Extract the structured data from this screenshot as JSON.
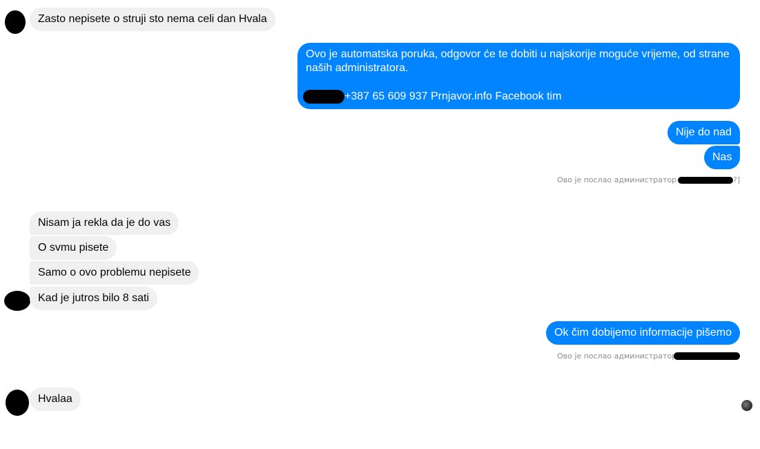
{
  "messages": {
    "m1": "Zasto nepisete o struji sto nema celi dan Hvala",
    "m2_line1": "Ovo je automatska poruka, odgovor će te dobiti u najskorije moguće vrijeme, od strane",
    "m2_line2": "naših administratora.",
    "m2_line3": "+387 65 609 937 Prnjavor.info Facebook tim",
    "m3": "Nije do nad",
    "m4": "Nas",
    "m5": "Nisam ja rekla da je do vas",
    "m6": "O svmu pisete",
    "m7": "Samo o ovo problemu nepisete",
    "m8": "Kad je jutros bilo 8 sati",
    "m9": "Ok čim dobijemo informacije pišemo",
    "m10": "Hvalaa"
  },
  "meta": {
    "sent_by_1": "Ово је послао администратор В",
    "sent_by_1_tail": "?]",
    "sent_by_2": "Ово је послао администратор В"
  },
  "colors": {
    "outgoing": "#0084ff",
    "incoming": "#f0f0f0",
    "meta_text": "#8a8d91"
  }
}
